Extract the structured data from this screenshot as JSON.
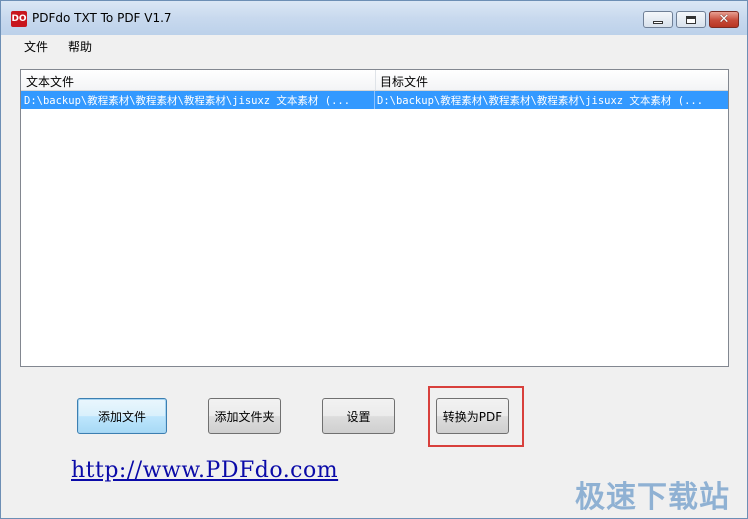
{
  "window": {
    "title": "PDFdo TXT To PDF V1.7",
    "app_icon_text": "DO",
    "controls": {
      "minimize": "minimize",
      "maximize": "maximize",
      "close": "✕"
    }
  },
  "menubar": {
    "items": [
      {
        "label": "文件"
      },
      {
        "label": "帮助"
      }
    ]
  },
  "file_list": {
    "columns": [
      {
        "label": "文本文件"
      },
      {
        "label": "目标文件"
      }
    ],
    "rows": [
      {
        "source": "D:\\backup\\教程素材\\教程素材\\教程素材\\jisuxz 文本素材 (...",
        "target": "D:\\backup\\教程素材\\教程素材\\教程素材\\jisuxz 文本素材 (...",
        "selected": true
      }
    ]
  },
  "buttons": {
    "add_file": "添加文件",
    "add_folder": "添加文件夹",
    "settings": "设置",
    "convert": "转换为PDF"
  },
  "link_text": "http://www.PDFdo.com",
  "watermark": "极速下载站",
  "colors": {
    "selection": "#3399ff",
    "highlight_box": "#d8403c",
    "link": "#0a0aa8"
  }
}
